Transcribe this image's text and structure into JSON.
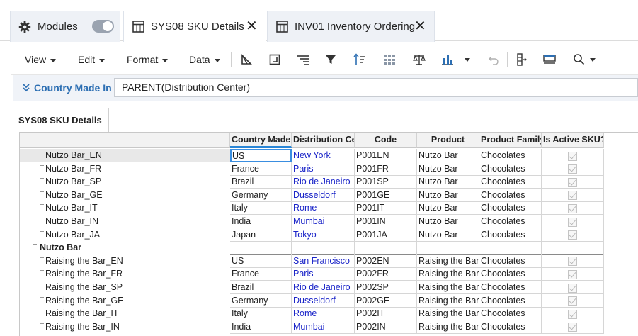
{
  "tabs": [
    {
      "label": "Modules",
      "icon": "gear-icon"
    },
    {
      "label": "SYS08 SKU Details",
      "icon": "grid-icon",
      "active": true
    },
    {
      "label": "INV01 Inventory Ordering",
      "icon": "grid-icon"
    }
  ],
  "toolbar": {
    "menus": [
      "View",
      "Edit",
      "Format",
      "Data"
    ]
  },
  "filter": {
    "label": "Country Made In",
    "value": "PARENT(Distribution Center)"
  },
  "sheet": {
    "tab_label": "SYS08 SKU Details"
  },
  "grid": {
    "columns": [
      "Country Made",
      "Distribution Ce",
      "Code",
      "Product",
      "Product Family",
      "Is Active SKU?"
    ],
    "rows": [
      {
        "label": "Nutzo Bar_EN",
        "level": 1,
        "country": "US",
        "center": "New York",
        "code": "P001EN",
        "product": "Nutzo Bar",
        "family": "Chocolates",
        "active": true
      },
      {
        "label": "Nutzo Bar_FR",
        "level": 1,
        "country": "France",
        "center": "Paris",
        "code": "P001FR",
        "product": "Nutzo Bar",
        "family": "Chocolates",
        "active": true
      },
      {
        "label": "Nutzo Bar_SP",
        "level": 1,
        "country": "Brazil",
        "center": "Rio de Janeiro",
        "code": "P001SP",
        "product": "Nutzo Bar",
        "family": "Chocolates",
        "active": true
      },
      {
        "label": "Nutzo Bar_GE",
        "level": 1,
        "country": "Germany",
        "center": "Dusseldorf",
        "code": "P001GE",
        "product": "Nutzo Bar",
        "family": "Chocolates",
        "active": true
      },
      {
        "label": "Nutzo Bar_IT",
        "level": 1,
        "country": "Italy",
        "center": "Rome",
        "code": "P001IT",
        "product": "Nutzo Bar",
        "family": "Chocolates",
        "active": true
      },
      {
        "label": "Nutzo Bar_IN",
        "level": 1,
        "country": "India",
        "center": "Mumbai",
        "code": "P001IN",
        "product": "Nutzo Bar",
        "family": "Chocolates",
        "active": true
      },
      {
        "label": "Nutzo Bar_JA",
        "level": 1,
        "country": "Japan",
        "center": "Tokyo",
        "code": "P001JA",
        "product": "Nutzo Bar",
        "family": "Chocolates",
        "active": true
      },
      {
        "label": "Nutzo Bar",
        "level": 0,
        "country": "",
        "center": "",
        "code": "",
        "product": "",
        "family": "",
        "active": null
      },
      {
        "label": "Raising the Bar_EN",
        "level": 2,
        "country": "US",
        "center": "San Francisco",
        "code": "P002EN",
        "product": "Raising the Bar",
        "family": "Chocolates",
        "active": true
      },
      {
        "label": "Raising the Bar_FR",
        "level": 2,
        "country": "France",
        "center": "Paris",
        "code": "P002FR",
        "product": "Raising the Bar",
        "family": "Chocolates",
        "active": true
      },
      {
        "label": "Raising the Bar_SP",
        "level": 2,
        "country": "Brazil",
        "center": "Rio de Janeiro",
        "code": "P002SP",
        "product": "Raising the Bar",
        "family": "Chocolates",
        "active": true
      },
      {
        "label": "Raising the Bar_GE",
        "level": 2,
        "country": "Germany",
        "center": "Dusseldorf",
        "code": "P002GE",
        "product": "Raising the Bar",
        "family": "Chocolates",
        "active": true
      },
      {
        "label": "Raising the Bar_IT",
        "level": 2,
        "country": "Italy",
        "center": "Rome",
        "code": "P002IT",
        "product": "Raising the Bar",
        "family": "Chocolates",
        "active": true
      },
      {
        "label": "Raising the Bar_IN",
        "level": 2,
        "country": "India",
        "center": "Mumbai",
        "code": "P002IN",
        "product": "Raising the Bar",
        "family": "Chocolates",
        "active": true
      }
    ]
  },
  "colors": {
    "accent": "#2d6fb3",
    "link": "#1a24c8",
    "selection": "#3a8ee0"
  }
}
